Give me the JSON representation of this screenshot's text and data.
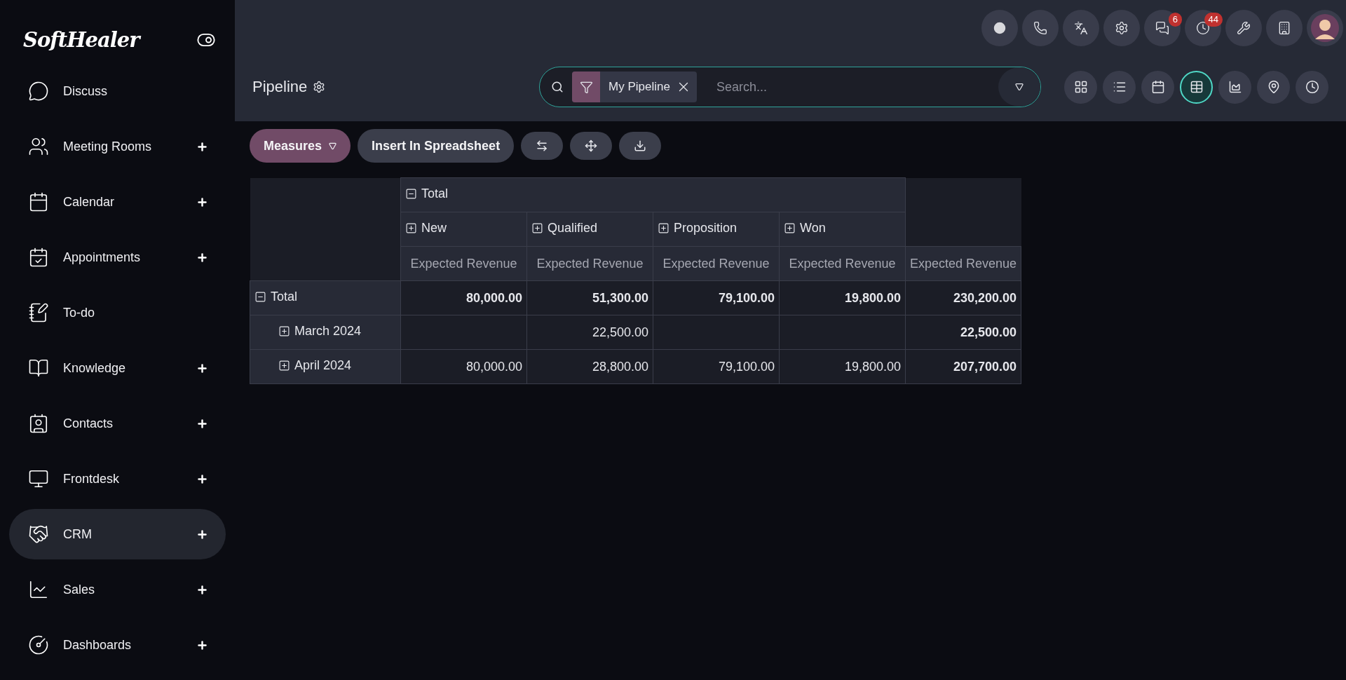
{
  "sidebar": {
    "logo": "SoftHealer",
    "items": [
      {
        "label": "Discuss",
        "expandable": false,
        "selected": false
      },
      {
        "label": "Meeting Rooms",
        "expandable": true,
        "selected": false
      },
      {
        "label": "Calendar",
        "expandable": true,
        "selected": false
      },
      {
        "label": "Appointments",
        "expandable": true,
        "selected": false
      },
      {
        "label": "To-do",
        "expandable": false,
        "selected": false
      },
      {
        "label": "Knowledge",
        "expandable": true,
        "selected": false
      },
      {
        "label": "Contacts",
        "expandable": true,
        "selected": false
      },
      {
        "label": "Frontdesk",
        "expandable": true,
        "selected": false
      },
      {
        "label": "CRM",
        "expandable": true,
        "selected": true
      },
      {
        "label": "Sales",
        "expandable": true,
        "selected": false
      },
      {
        "label": "Dashboards",
        "expandable": true,
        "selected": false
      }
    ]
  },
  "systray": {
    "message_badge": "6",
    "activity_badge": "44"
  },
  "control_panel": {
    "title": "Pipeline",
    "search": {
      "facets": [
        {
          "label": "My Pipeline"
        }
      ],
      "placeholder": "Search..."
    },
    "views": [
      {
        "kind": "kanban",
        "selected": false
      },
      {
        "kind": "list",
        "selected": false
      },
      {
        "kind": "calendar",
        "selected": false
      },
      {
        "kind": "pivot",
        "selected": true
      },
      {
        "kind": "graph",
        "selected": false
      },
      {
        "kind": "map",
        "selected": false
      },
      {
        "kind": "activity",
        "selected": false
      }
    ]
  },
  "toolbar": {
    "measures": "Measures",
    "insert": "Insert In Spreadsheet"
  },
  "pivot": {
    "column_header": {
      "label": "Total",
      "expanded": true,
      "children": [
        {
          "label": "New",
          "expanded": false
        },
        {
          "label": "Qualified",
          "expanded": false
        },
        {
          "label": "Proposition",
          "expanded": false
        },
        {
          "label": "Won",
          "expanded": false
        }
      ]
    },
    "measure_headers": [
      "Expected Revenue",
      "Expected Revenue",
      "Expected Revenue",
      "Expected Revenue",
      "Expected Revenue"
    ],
    "rows": [
      {
        "label": "Total",
        "expanded": true,
        "values": {
          "c0": "80,000.00",
          "c1": "51,300.00",
          "c2": "79,100.00",
          "c3": "19,800.00",
          "c4": "230,200.00"
        },
        "children": [
          {
            "label": "March 2024",
            "expanded": false,
            "values": {
              "c1": "22,500.00",
              "c4": "22,500.00"
            }
          },
          {
            "label": "April 2024",
            "expanded": false,
            "values": {
              "c0": "80,000.00",
              "c1": "28,800.00",
              "c2": "79,100.00",
              "c3": "19,800.00",
              "c4": "207,700.00"
            }
          }
        ]
      }
    ]
  }
}
